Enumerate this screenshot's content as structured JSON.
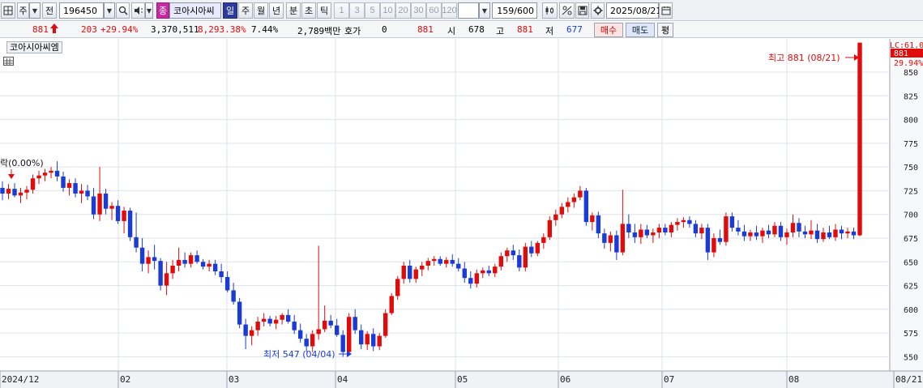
{
  "toolbar": {
    "mode_1": "주",
    "mode_2": "전",
    "code": "196450",
    "badge": "종",
    "stock_name": "코아시아씨",
    "periods": [
      "일",
      "주",
      "월",
      "년",
      "분",
      "초",
      "틱"
    ],
    "selected_period": "일",
    "intervals": [
      "1",
      "3",
      "5",
      "10",
      "20",
      "30",
      "60",
      "120"
    ],
    "count": "159/600",
    "date": "2025/08/21",
    "icons": [
      "grid-icon",
      "search-icon",
      "sound-icon",
      "chart-indicator-icon",
      "chart-tool-icon",
      "save-icon",
      "gear-icon",
      "calendar-icon"
    ]
  },
  "quote": {
    "price": "881",
    "change": "203",
    "change_pct": "+29.94%",
    "volume": "3,370,511",
    "volume_pct": "8,293.38%",
    "turnover_pct": "7.44%",
    "amount": "2,789백만",
    "hoga_label": "호가",
    "hoga_value": "0",
    "hoga_price": "881",
    "open_label": "시",
    "open_value": "678",
    "high_label": "고",
    "high_value": "881",
    "low_label": "저",
    "low_value": "677",
    "buy_label": "매수",
    "sell_label": "매도",
    "avg_label": "평",
    "colors": {
      "up": "#e00b0b",
      "down": "#1a3bd6"
    }
  },
  "chart": {
    "stock_tag": "코아시아씨엠",
    "current_price_tag": "881",
    "current_pct_tag": "29.94%",
    "lc_label": "LC:61.0",
    "high_annotation": "최고 881 (08/21)",
    "low_annotation": "최저 547 (04/04)",
    "left_annotation": "락(0.00%)",
    "x_labels": [
      "2024/12",
      "02",
      "03",
      "04",
      "05",
      "06",
      "07",
      "08",
      "08/21"
    ],
    "colors": {
      "up": "#e00b0b",
      "down": "#1a3bd6",
      "grid": "#dde2ea",
      "axis_bg": "#f7f8fa"
    }
  },
  "chart_data": {
    "type": "candlestick",
    "y_ticks": [
      850,
      825,
      800,
      775,
      750,
      725,
      700,
      675,
      650,
      625,
      600,
      575,
      550
    ],
    "ylim": [
      535,
      885
    ],
    "candles": [
      {
        "o": 728,
        "h": 735,
        "l": 715,
        "c": 722
      },
      {
        "o": 722,
        "h": 732,
        "l": 716,
        "c": 727
      },
      {
        "o": 727,
        "h": 733,
        "l": 718,
        "c": 720
      },
      {
        "o": 720,
        "h": 728,
        "l": 712,
        "c": 723
      },
      {
        "o": 723,
        "h": 730,
        "l": 716,
        "c": 726
      },
      {
        "o": 726,
        "h": 742,
        "l": 722,
        "c": 738
      },
      {
        "o": 738,
        "h": 746,
        "l": 732,
        "c": 741
      },
      {
        "o": 741,
        "h": 748,
        "l": 735,
        "c": 744
      },
      {
        "o": 744,
        "h": 750,
        "l": 738,
        "c": 746
      },
      {
        "o": 746,
        "h": 756,
        "l": 735,
        "c": 740
      },
      {
        "o": 740,
        "h": 745,
        "l": 724,
        "c": 728
      },
      {
        "o": 728,
        "h": 737,
        "l": 720,
        "c": 733
      },
      {
        "o": 733,
        "h": 738,
        "l": 718,
        "c": 722
      },
      {
        "o": 722,
        "h": 732,
        "l": 712,
        "c": 725
      },
      {
        "o": 725,
        "h": 731,
        "l": 715,
        "c": 719
      },
      {
        "o": 719,
        "h": 728,
        "l": 695,
        "c": 700
      },
      {
        "o": 700,
        "h": 750,
        "l": 693,
        "c": 722
      },
      {
        "o": 722,
        "h": 727,
        "l": 700,
        "c": 706
      },
      {
        "o": 706,
        "h": 713,
        "l": 694,
        "c": 709
      },
      {
        "o": 709,
        "h": 715,
        "l": 690,
        "c": 693
      },
      {
        "o": 693,
        "h": 708,
        "l": 680,
        "c": 704
      },
      {
        "o": 704,
        "h": 707,
        "l": 672,
        "c": 676
      },
      {
        "o": 676,
        "h": 702,
        "l": 660,
        "c": 665
      },
      {
        "o": 665,
        "h": 675,
        "l": 640,
        "c": 648
      },
      {
        "o": 648,
        "h": 662,
        "l": 638,
        "c": 655
      },
      {
        "o": 655,
        "h": 668,
        "l": 642,
        "c": 651
      },
      {
        "o": 651,
        "h": 654,
        "l": 620,
        "c": 625
      },
      {
        "o": 625,
        "h": 650,
        "l": 615,
        "c": 638
      },
      {
        "o": 638,
        "h": 652,
        "l": 632,
        "c": 646
      },
      {
        "o": 646,
        "h": 665,
        "l": 640,
        "c": 652
      },
      {
        "o": 652,
        "h": 660,
        "l": 644,
        "c": 648
      },
      {
        "o": 648,
        "h": 660,
        "l": 644,
        "c": 657
      },
      {
        "o": 657,
        "h": 662,
        "l": 648,
        "c": 650
      },
      {
        "o": 650,
        "h": 653,
        "l": 642,
        "c": 645
      },
      {
        "o": 645,
        "h": 652,
        "l": 640,
        "c": 648
      },
      {
        "o": 648,
        "h": 652,
        "l": 636,
        "c": 640
      },
      {
        "o": 640,
        "h": 648,
        "l": 628,
        "c": 634
      },
      {
        "o": 634,
        "h": 640,
        "l": 618,
        "c": 620
      },
      {
        "o": 620,
        "h": 628,
        "l": 605,
        "c": 608
      },
      {
        "o": 608,
        "h": 612,
        "l": 580,
        "c": 584
      },
      {
        "o": 584,
        "h": 590,
        "l": 558,
        "c": 572
      },
      {
        "o": 572,
        "h": 582,
        "l": 562,
        "c": 578
      },
      {
        "o": 578,
        "h": 592,
        "l": 572,
        "c": 587
      },
      {
        "o": 587,
        "h": 596,
        "l": 582,
        "c": 590
      },
      {
        "o": 590,
        "h": 593,
        "l": 582,
        "c": 585
      },
      {
        "o": 585,
        "h": 593,
        "l": 579,
        "c": 589
      },
      {
        "o": 589,
        "h": 596,
        "l": 584,
        "c": 594
      },
      {
        "o": 594,
        "h": 600,
        "l": 585,
        "c": 587
      },
      {
        "o": 587,
        "h": 594,
        "l": 574,
        "c": 578
      },
      {
        "o": 578,
        "h": 585,
        "l": 565,
        "c": 569
      },
      {
        "o": 569,
        "h": 574,
        "l": 555,
        "c": 561
      },
      {
        "o": 561,
        "h": 578,
        "l": 555,
        "c": 574
      },
      {
        "o": 574,
        "h": 667,
        "l": 568,
        "c": 579
      },
      {
        "o": 579,
        "h": 604,
        "l": 576,
        "c": 588
      },
      {
        "o": 588,
        "h": 594,
        "l": 580,
        "c": 583
      },
      {
        "o": 583,
        "h": 590,
        "l": 571,
        "c": 573
      },
      {
        "o": 573,
        "h": 578,
        "l": 550,
        "c": 555
      },
      {
        "o": 555,
        "h": 596,
        "l": 553,
        "c": 592
      },
      {
        "o": 592,
        "h": 600,
        "l": 574,
        "c": 578
      },
      {
        "o": 578,
        "h": 584,
        "l": 558,
        "c": 563
      },
      {
        "o": 563,
        "h": 577,
        "l": 557,
        "c": 574
      },
      {
        "o": 574,
        "h": 580,
        "l": 556,
        "c": 561
      },
      {
        "o": 561,
        "h": 575,
        "l": 557,
        "c": 572
      },
      {
        "o": 572,
        "h": 600,
        "l": 570,
        "c": 596
      },
      {
        "o": 596,
        "h": 617,
        "l": 594,
        "c": 614
      },
      {
        "o": 614,
        "h": 635,
        "l": 610,
        "c": 632
      },
      {
        "o": 632,
        "h": 650,
        "l": 627,
        "c": 646
      },
      {
        "o": 646,
        "h": 652,
        "l": 628,
        "c": 632
      },
      {
        "o": 632,
        "h": 645,
        "l": 628,
        "c": 642
      },
      {
        "o": 642,
        "h": 650,
        "l": 635,
        "c": 646
      },
      {
        "o": 646,
        "h": 654,
        "l": 641,
        "c": 651
      },
      {
        "o": 651,
        "h": 656,
        "l": 646,
        "c": 653
      },
      {
        "o": 653,
        "h": 656,
        "l": 646,
        "c": 648
      },
      {
        "o": 648,
        "h": 655,
        "l": 644,
        "c": 652
      },
      {
        "o": 652,
        "h": 658,
        "l": 645,
        "c": 648
      },
      {
        "o": 648,
        "h": 654,
        "l": 640,
        "c": 643
      },
      {
        "o": 643,
        "h": 650,
        "l": 628,
        "c": 633
      },
      {
        "o": 633,
        "h": 640,
        "l": 622,
        "c": 627
      },
      {
        "o": 627,
        "h": 642,
        "l": 623,
        "c": 638
      },
      {
        "o": 638,
        "h": 644,
        "l": 633,
        "c": 641
      },
      {
        "o": 641,
        "h": 646,
        "l": 635,
        "c": 638
      },
      {
        "o": 638,
        "h": 648,
        "l": 634,
        "c": 645
      },
      {
        "o": 645,
        "h": 660,
        "l": 641,
        "c": 656
      },
      {
        "o": 656,
        "h": 665,
        "l": 650,
        "c": 662
      },
      {
        "o": 662,
        "h": 668,
        "l": 652,
        "c": 657
      },
      {
        "o": 657,
        "h": 663,
        "l": 640,
        "c": 644
      },
      {
        "o": 644,
        "h": 670,
        "l": 640,
        "c": 666
      },
      {
        "o": 666,
        "h": 672,
        "l": 655,
        "c": 659
      },
      {
        "o": 659,
        "h": 672,
        "l": 656,
        "c": 670
      },
      {
        "o": 670,
        "h": 680,
        "l": 664,
        "c": 676
      },
      {
        "o": 676,
        "h": 698,
        "l": 673,
        "c": 694
      },
      {
        "o": 694,
        "h": 705,
        "l": 688,
        "c": 700
      },
      {
        "o": 700,
        "h": 712,
        "l": 696,
        "c": 708
      },
      {
        "o": 708,
        "h": 718,
        "l": 702,
        "c": 713
      },
      {
        "o": 713,
        "h": 722,
        "l": 707,
        "c": 718
      },
      {
        "o": 718,
        "h": 730,
        "l": 715,
        "c": 725
      },
      {
        "o": 725,
        "h": 728,
        "l": 688,
        "c": 692
      },
      {
        "o": 692,
        "h": 702,
        "l": 683,
        "c": 699
      },
      {
        "o": 699,
        "h": 703,
        "l": 675,
        "c": 680
      },
      {
        "o": 680,
        "h": 685,
        "l": 664,
        "c": 670
      },
      {
        "o": 670,
        "h": 682,
        "l": 661,
        "c": 678
      },
      {
        "o": 678,
        "h": 683,
        "l": 652,
        "c": 660
      },
      {
        "o": 660,
        "h": 726,
        "l": 657,
        "c": 690
      },
      {
        "o": 690,
        "h": 700,
        "l": 675,
        "c": 681
      },
      {
        "o": 681,
        "h": 690,
        "l": 670,
        "c": 676
      },
      {
        "o": 676,
        "h": 690,
        "l": 669,
        "c": 684
      },
      {
        "o": 684,
        "h": 689,
        "l": 675,
        "c": 678
      },
      {
        "o": 678,
        "h": 685,
        "l": 670,
        "c": 681
      },
      {
        "o": 681,
        "h": 690,
        "l": 675,
        "c": 686
      },
      {
        "o": 686,
        "h": 690,
        "l": 678,
        "c": 681
      },
      {
        "o": 681,
        "h": 692,
        "l": 676,
        "c": 689
      },
      {
        "o": 689,
        "h": 696,
        "l": 683,
        "c": 692
      },
      {
        "o": 692,
        "h": 697,
        "l": 686,
        "c": 694
      },
      {
        "o": 694,
        "h": 698,
        "l": 686,
        "c": 690
      },
      {
        "o": 690,
        "h": 694,
        "l": 676,
        "c": 680
      },
      {
        "o": 680,
        "h": 690,
        "l": 674,
        "c": 686
      },
      {
        "o": 686,
        "h": 690,
        "l": 652,
        "c": 660
      },
      {
        "o": 660,
        "h": 680,
        "l": 655,
        "c": 675
      },
      {
        "o": 675,
        "h": 684,
        "l": 668,
        "c": 671
      },
      {
        "o": 671,
        "h": 702,
        "l": 667,
        "c": 698
      },
      {
        "o": 698,
        "h": 702,
        "l": 682,
        "c": 686
      },
      {
        "o": 686,
        "h": 694,
        "l": 678,
        "c": 682
      },
      {
        "o": 682,
        "h": 689,
        "l": 672,
        "c": 677
      },
      {
        "o": 677,
        "h": 684,
        "l": 672,
        "c": 681
      },
      {
        "o": 681,
        "h": 688,
        "l": 673,
        "c": 677
      },
      {
        "o": 677,
        "h": 686,
        "l": 670,
        "c": 683
      },
      {
        "o": 683,
        "h": 689,
        "l": 675,
        "c": 679
      },
      {
        "o": 679,
        "h": 692,
        "l": 676,
        "c": 688
      },
      {
        "o": 688,
        "h": 692,
        "l": 672,
        "c": 676
      },
      {
        "o": 676,
        "h": 685,
        "l": 668,
        "c": 681
      },
      {
        "o": 681,
        "h": 700,
        "l": 676,
        "c": 691
      },
      {
        "o": 691,
        "h": 696,
        "l": 676,
        "c": 682
      },
      {
        "o": 682,
        "h": 688,
        "l": 675,
        "c": 679
      },
      {
        "o": 679,
        "h": 694,
        "l": 674,
        "c": 683
      },
      {
        "o": 683,
        "h": 690,
        "l": 670,
        "c": 674
      },
      {
        "o": 674,
        "h": 686,
        "l": 671,
        "c": 681
      },
      {
        "o": 681,
        "h": 688,
        "l": 674,
        "c": 676
      },
      {
        "o": 676,
        "h": 690,
        "l": 672,
        "c": 684
      },
      {
        "o": 684,
        "h": 688,
        "l": 674,
        "c": 680
      },
      {
        "o": 680,
        "h": 686,
        "l": 675,
        "c": 682
      },
      {
        "o": 682,
        "h": 686,
        "l": 674,
        "c": 678
      },
      {
        "o": 678,
        "h": 881,
        "l": 677,
        "c": 881
      }
    ]
  }
}
